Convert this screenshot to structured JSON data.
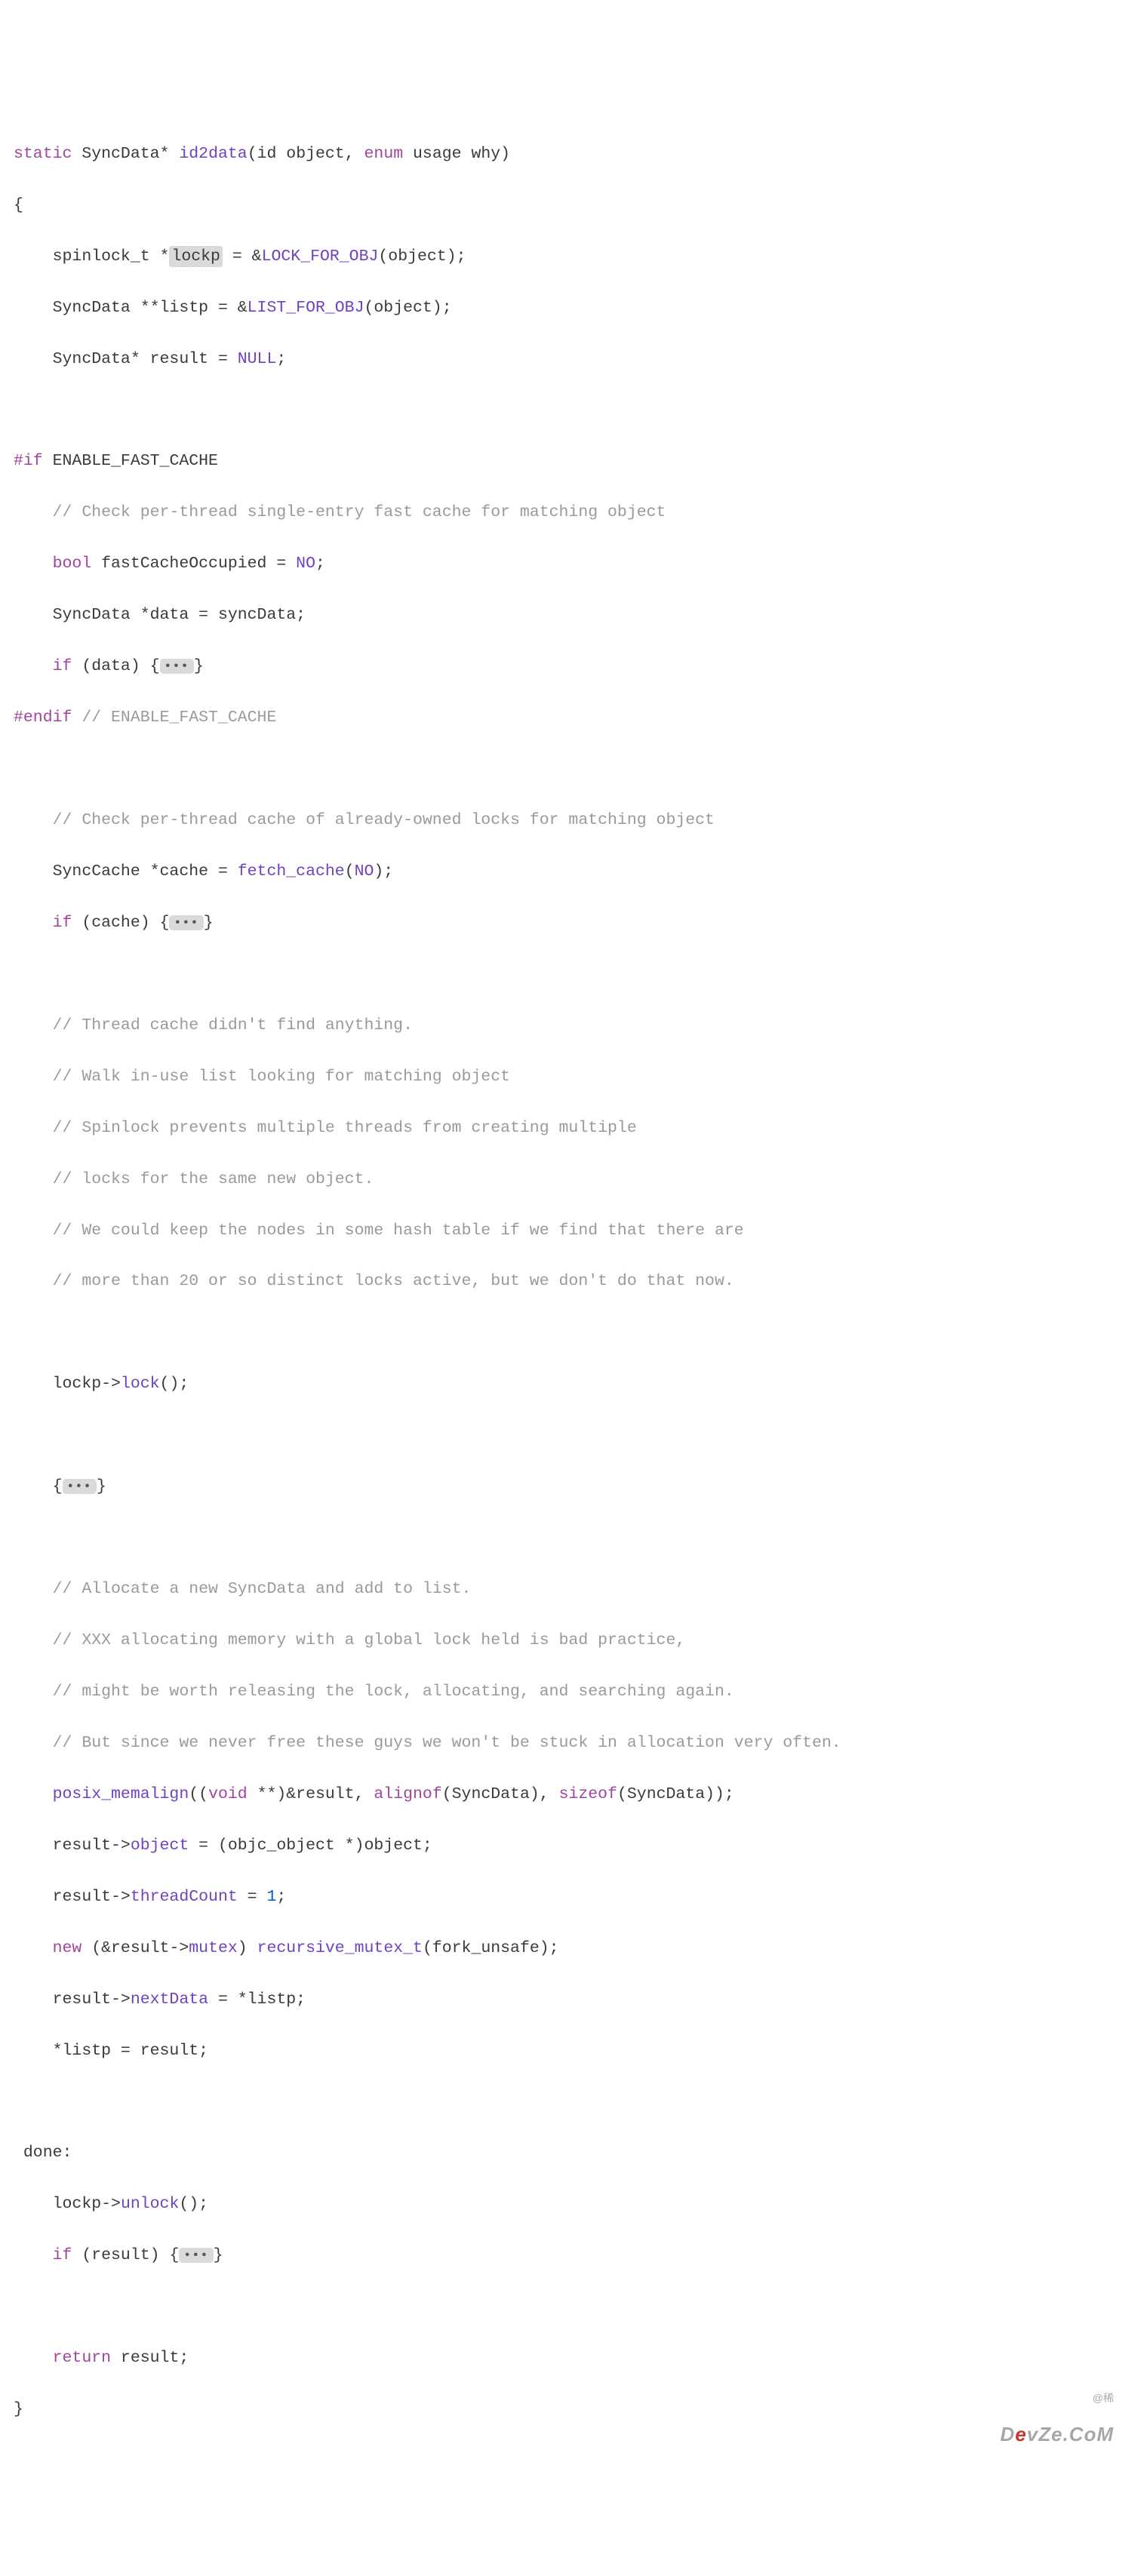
{
  "code": {
    "l1": {
      "kw1": "static",
      "type": "SyncData*",
      "fn": "id2data",
      "p": "(id object, ",
      "kw2": "enum",
      "p2": " usage why)"
    },
    "l2": "{",
    "l3": {
      "pre": "    spinlock_t *",
      "hl": "lockp",
      "post": " = &",
      "mac": "LOCK_FOR_OBJ",
      "tail": "(object);"
    },
    "l4": {
      "pre": "    SyncData **listp = &",
      "mac": "LIST_FOR_OBJ",
      "tail": "(object);"
    },
    "l5": {
      "pre": "    SyncData* result = ",
      "mac": "NULL",
      "tail": ";"
    },
    "l7": {
      "pp": "#if",
      "id": " ENABLE_FAST_CACHE"
    },
    "c8": "    // Check per-thread single-entry fast cache for matching object",
    "l9": {
      "pre": "    ",
      "kw": "bool",
      "post": " fastCacheOccupied = ",
      "mac": "NO",
      "tail": ";"
    },
    "l10": "    SyncData *data = syncData;",
    "l11": {
      "pre": "    ",
      "kw": "if",
      "post": " (data) {",
      "tail": "}"
    },
    "l12": {
      "pp": "#endif",
      "com": " // ENABLE_FAST_CACHE"
    },
    "c14": "    // Check per-thread cache of already-owned locks for matching object",
    "l15": {
      "pre": "    SyncCache *cache = ",
      "fn": "fetch_cache",
      "mid": "(",
      "mac": "NO",
      "tail": ");"
    },
    "l16": {
      "pre": "    ",
      "kw": "if",
      "post": " (cache) {",
      "tail": "}"
    },
    "c18": "    // Thread cache didn't find anything.",
    "c19": "    // Walk in-use list looking for matching object",
    "c20": "    // Spinlock prevents multiple threads from creating multiple",
    "c21": "    // locks for the same new object.",
    "c22": "    // We could keep the nodes in some hash table if we find that there are",
    "c23": "    // more than 20 or so distinct locks active, but we don't do that now.",
    "l25": {
      "pre": "    lockp->",
      "fn": "lock",
      "tail": "();"
    },
    "l27": {
      "pre": "    {",
      "tail": "}"
    },
    "c29": "    // Allocate a new SyncData and add to list.",
    "c30": "    // XXX allocating memory with a global lock held is bad practice,",
    "c31": "    // might be worth releasing the lock, allocating, and searching again.",
    "c32": "    // But since we never free these guys we won't be stuck in allocation very often.",
    "l33": {
      "pre": "    ",
      "fn": "posix_memalign",
      "p1": "((",
      "kw": "void",
      "p2": " **)&result, ",
      "al": "alignof",
      "p3": "(SyncData), ",
      "sz": "sizeof",
      "p4": "(SyncData));"
    },
    "l34": {
      "pre": "    result->",
      "mem": "object",
      "tail": " = (objc_object *)object;"
    },
    "l35": {
      "pre": "    result->",
      "mem": "threadCount",
      "tail": " = ",
      "num": "1",
      "tail2": ";"
    },
    "l36": {
      "pre": "    ",
      "kw": "new",
      "p1": " (&result->",
      "mem": "mutex",
      "p2": ") ",
      "fn": "recursive_mutex_t",
      "tail": "(fork_unsafe);"
    },
    "l37": {
      "pre": "    result->",
      "mem": "nextData",
      "tail": " = *listp;"
    },
    "l38": "    *listp = result;",
    "l40": " done:",
    "l41": {
      "pre": "    lockp->",
      "fn": "unlock",
      "tail": "();"
    },
    "l42": {
      "pre": "    ",
      "kw": "if",
      "post": " (result) {",
      "tail": "}"
    },
    "l44": {
      "pre": "    ",
      "kw": "return",
      "tail": " result;"
    },
    "l45": "}"
  },
  "fold_glyph": "•••",
  "watermark": {
    "small": "@稀",
    "brand_pre": "D",
    "brand_o": "e",
    "brand_post": "vZe.CoM"
  }
}
